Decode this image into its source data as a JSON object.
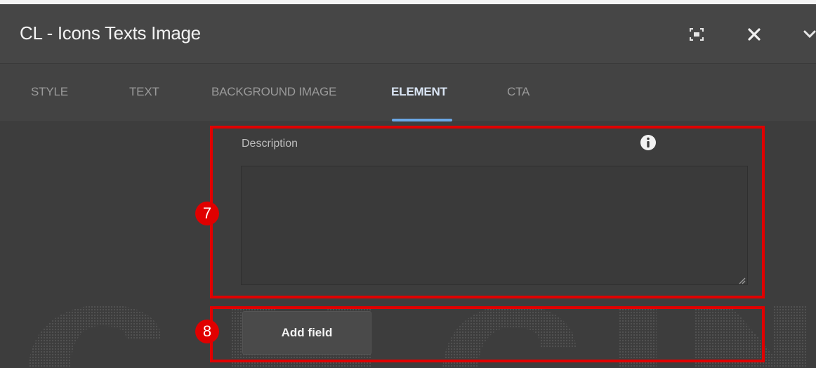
{
  "dialog": {
    "title": "CL - Icons Texts Image"
  },
  "tabs": [
    {
      "label": "STYLE"
    },
    {
      "label": "TEXT"
    },
    {
      "label": "BACKGROUND IMAGE"
    },
    {
      "label": "ELEMENT"
    },
    {
      "label": "CTA"
    }
  ],
  "active_tab": "ELEMENT",
  "description": {
    "label": "Description",
    "value": ""
  },
  "add_field": {
    "label": "Add field"
  },
  "annotations": [
    {
      "number": "7"
    },
    {
      "number": "8"
    }
  ],
  "colors": {
    "accent": "#6aa7e6",
    "annotation": "#e00000",
    "background": "#3d3d3d",
    "titlebar": "#464646"
  },
  "icons": [
    "fullscreen-icon",
    "close-icon",
    "chevron-down-icon",
    "info-icon",
    "resize-grip-icon"
  ]
}
